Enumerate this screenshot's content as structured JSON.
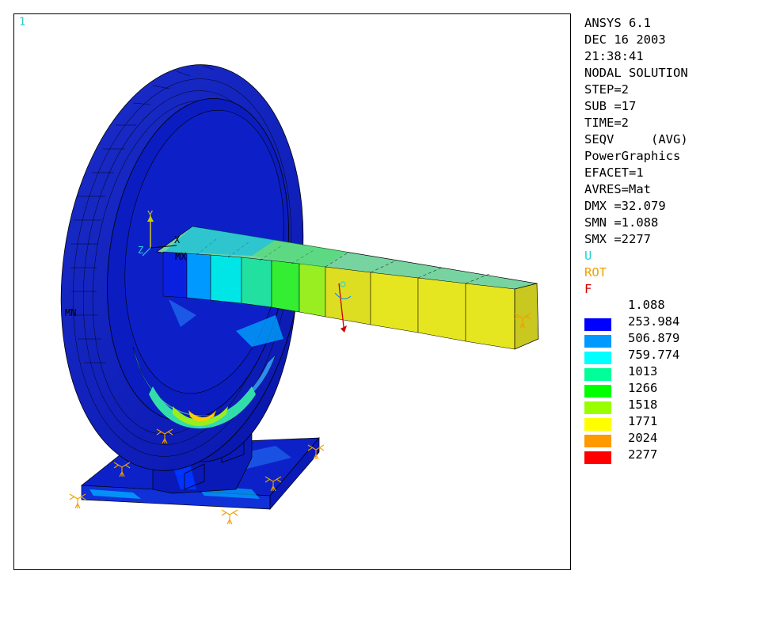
{
  "window_number": "1",
  "info_lines": [
    "ANSYS 6.1",
    "DEC 16 2003",
    "21:38:41",
    "NODAL SOLUTION",
    "STEP=2",
    "SUB =17",
    "TIME=2",
    "SEQV     (AVG)",
    "PowerGraphics",
    "EFACET=1",
    "AVRES=Mat",
    "DMX =32.079",
    "SMN =1.088",
    "SMX =2277"
  ],
  "bc_symbols": {
    "u": "U",
    "rot": "ROT",
    "f": "F",
    "u_color": "#22d3d3",
    "rot_color": "#f0a000",
    "f_color": "#d00000"
  },
  "legend": {
    "min_label": "1.088",
    "bands": [
      {
        "label": "253.984",
        "color": "#0000ff"
      },
      {
        "label": "506.879",
        "color": "#0099ff"
      },
      {
        "label": "759.774",
        "color": "#00ffff"
      },
      {
        "label": "1013",
        "color": "#00ff99"
      },
      {
        "label": "1266",
        "color": "#00ff00"
      },
      {
        "label": "1518",
        "color": "#99ff00"
      },
      {
        "label": "1771",
        "color": "#ffff00"
      },
      {
        "label": "2024",
        "color": "#ff9900"
      },
      {
        "label": "2277",
        "color": "#ff0000"
      }
    ]
  },
  "triad": {
    "y": "Y",
    "z": "Z",
    "x": "X",
    "mx": "MX",
    "mn": "MN"
  }
}
